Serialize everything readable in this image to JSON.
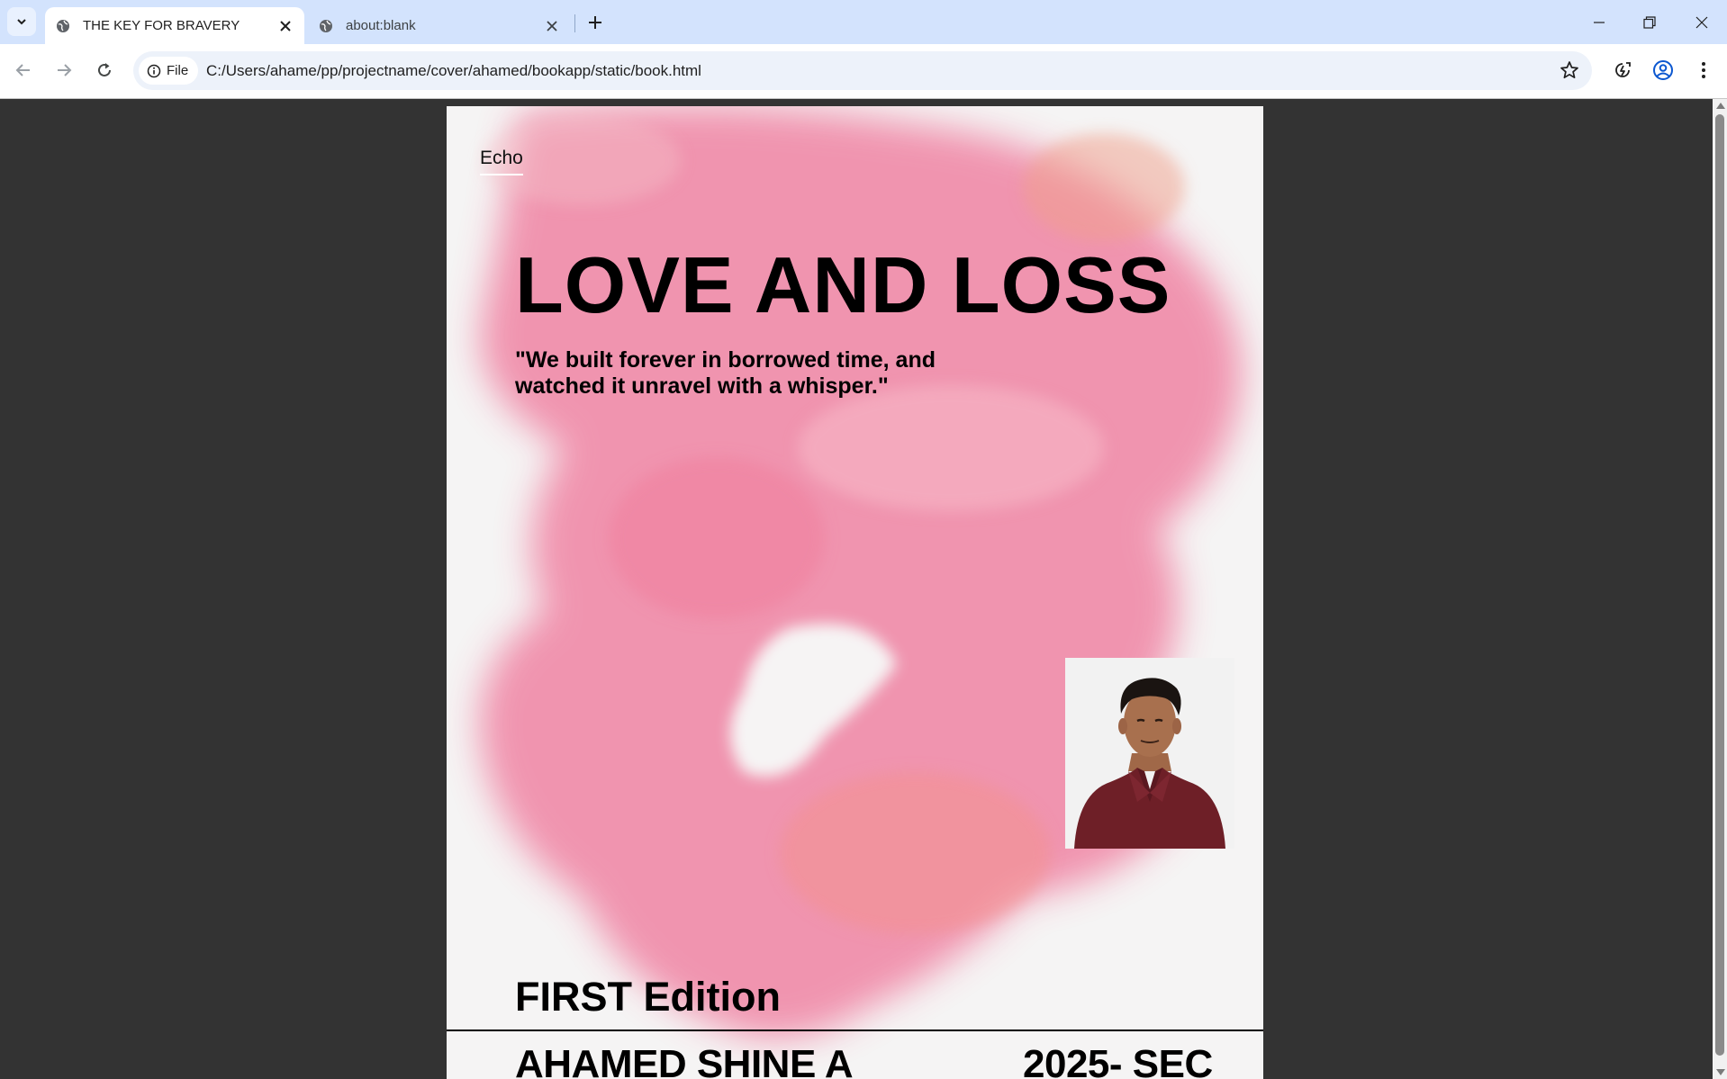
{
  "browser": {
    "tabs": [
      {
        "title": "THE KEY FOR BRAVERY",
        "active": true
      },
      {
        "title": "about:blank",
        "active": false
      }
    ],
    "address": {
      "chip_label": "File",
      "url": "C:/Users/ahame/pp/projectname/cover/ahamed/bookapp/static/book.html"
    }
  },
  "cover": {
    "series": "Echo",
    "title": "LOVE AND LOSS",
    "tagline": "\"We built forever in borrowed time, and watched it unravel with a whisper.\"",
    "edition": "FIRST Edition",
    "author": "AHAMED SHINE A",
    "year": "2025- SEC"
  },
  "colors": {
    "tabstrip": "#d3e3fd",
    "page_background": "#333333",
    "cover_background": "#f5f4f4",
    "watercolor_pink": "#f08aa8",
    "shirt_maroon": "#6e1f27"
  }
}
